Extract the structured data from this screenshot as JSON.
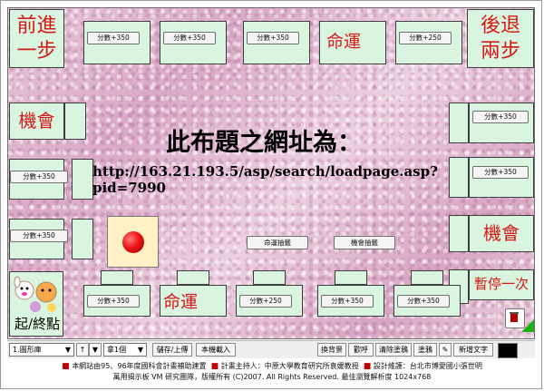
{
  "board": {
    "center_title": "此布題之網址為：",
    "center_url": "http://163.21.193.5/asp/search/loadpage.asp?pid=7990",
    "middle_buttons": {
      "fate": "命運抽籤",
      "chance": "機會抽籤"
    },
    "top_buttons": [
      "分數+350",
      "分數+350",
      "分數+350",
      "分數+250"
    ],
    "bottom_buttons": [
      "分數+350",
      "分數+250",
      "分數+350",
      "分數+350"
    ],
    "left_buttons": [
      "分數+350",
      "分數+350"
    ],
    "right_buttons": [
      "分數+350",
      "分數+350",
      "分數+350"
    ],
    "corners": {
      "top_left": "前進\n一步",
      "top_right": "後退\n兩步",
      "left_chance": "機會",
      "top_fate": "命運",
      "bottom_fate": "命運",
      "right_chance": "機會",
      "right_pause": "暫停一次",
      "bottom_left": "起/終點"
    },
    "top_tile_labels": [
      "分數+350",
      "分數+350",
      "分數+350",
      "命運",
      "分數+250"
    ]
  },
  "toolbar": {
    "library_select": "1.圖形庫",
    "count_select": "拿1個",
    "save_upload": "儲存/上傳",
    "load_local": "本機載入",
    "change_bg": "換背景",
    "cheer": "歡呼",
    "clear_paint": "清除塗鴉",
    "paint": "塗鴉",
    "new_text": "新增文字"
  },
  "footer": {
    "line1": "本網站由95、96年度國科會計畫補助建置",
    "line1b": "計畫主持人：中原大學教育研究所袁媛教授",
    "line1c": "設計維護：台北市博愛國小張世明",
    "line2": "萬用揭示板 VM 研究團隊，版權所有 (C)2007. All Rights Reserved. 最佳瀏覽解析度 1024x768"
  }
}
